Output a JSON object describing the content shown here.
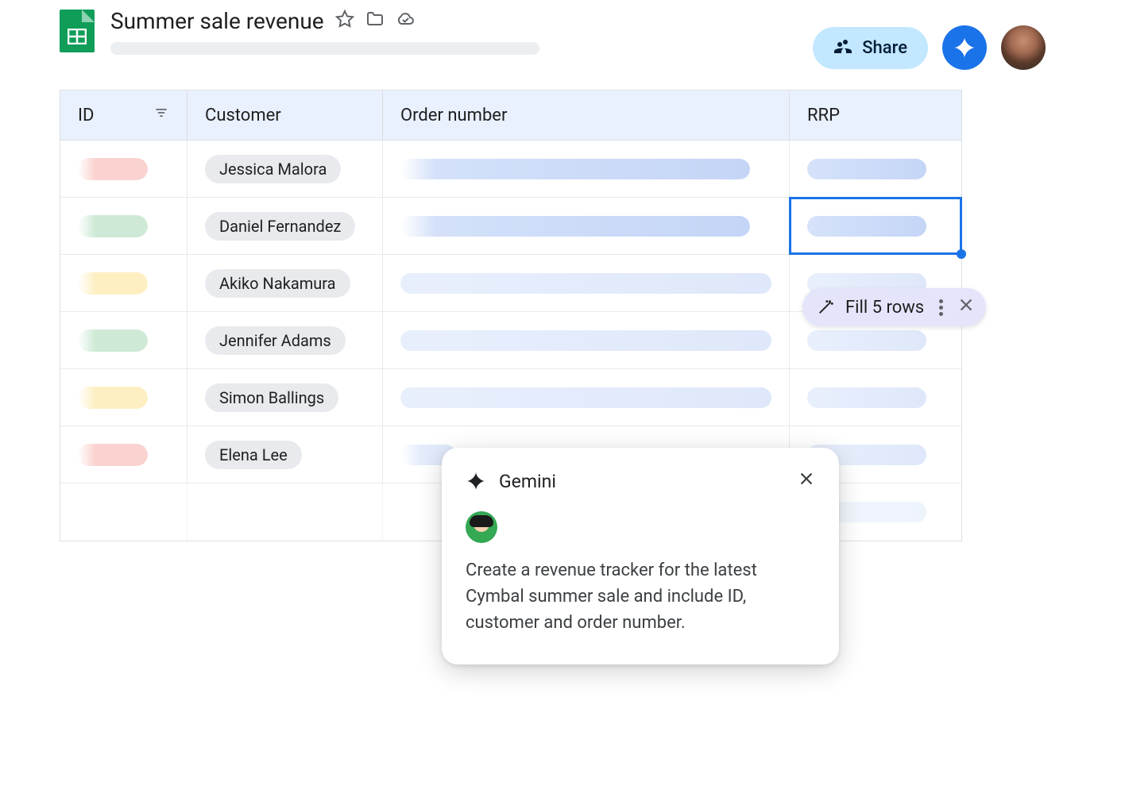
{
  "document": {
    "title": "Summer sale revenue"
  },
  "header_actions": {
    "share": "Share"
  },
  "table": {
    "columns": {
      "id": "ID",
      "customer": "Customer",
      "order_number": "Order number",
      "rrp": "RRP"
    },
    "rows": [
      {
        "customer": "Jessica Malora",
        "id_color": "red"
      },
      {
        "customer": "Daniel Fernandez",
        "id_color": "green"
      },
      {
        "customer": "Akiko Nakamura",
        "id_color": "yellow"
      },
      {
        "customer": "Jennifer Adams",
        "id_color": "green"
      },
      {
        "customer": "Simon Ballings",
        "id_color": "yellow"
      },
      {
        "customer": "Elena Lee",
        "id_color": "red"
      }
    ]
  },
  "fill_suggestion": {
    "label": "Fill 5 rows"
  },
  "gemini_panel": {
    "title": "Gemini",
    "prompt": "Create a revenue tracker for the latest Cymbal summer sale and include ID, customer and order number."
  }
}
